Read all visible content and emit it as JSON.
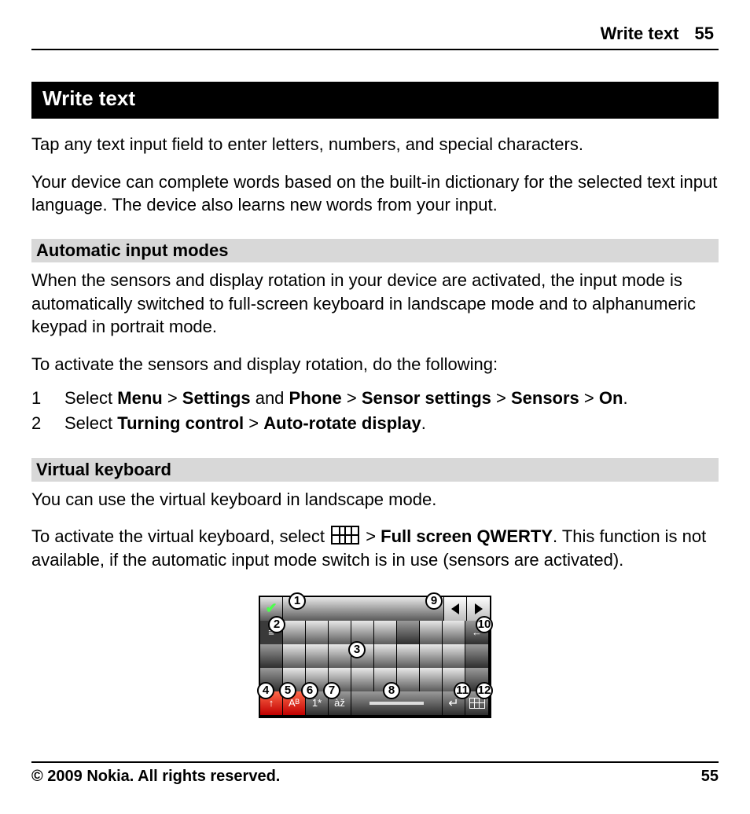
{
  "header": {
    "section": "Write text",
    "page": "55"
  },
  "title": "Write text",
  "para1": "Tap any text input field to enter letters, numbers, and special characters.",
  "para2": "Your device can complete words based on the built-in dictionary for the selected text input language. The device also learns new words from your input.",
  "sub1": "Automatic input modes",
  "para3": "When the sensors and display rotation in your device are activated, the input mode is automatically switched to full-screen keyboard in landscape mode and to alphanumeric keypad in portrait mode.",
  "para4": "To activate the sensors and display rotation, do the following:",
  "steps": {
    "s1": {
      "num": "1",
      "pre": "Select ",
      "m1": "Menu",
      "sep1": " > ",
      "m2": "Settings",
      "mid": " and ",
      "m3": "Phone",
      "sep2": " > ",
      "m4": "Sensor settings",
      "sep3": " > ",
      "m5": "Sensors",
      "sep4": " > ",
      "m6": "On",
      "end": "."
    },
    "s2": {
      "num": "2",
      "pre": "Select ",
      "m1": "Turning control",
      "sep1": " > ",
      "m2": "Auto-rotate display",
      "end": "."
    }
  },
  "sub2": "Virtual keyboard",
  "para5": "You can use the virtual keyboard in landscape mode.",
  "para6a": "To activate the virtual keyboard, select ",
  "para6sep": " > ",
  "para6b": "Full screen QWERTY",
  "para6c": ". This function is not available, if the automatic input mode switch is in use (sensors are activated).",
  "kb_labels": {
    "shift": "↑",
    "abc": "Aᴮ",
    "onestar": "1*",
    "accents": "àž",
    "back": "←"
  },
  "callouts": [
    "1",
    "2",
    "3",
    "4",
    "5",
    "6",
    "7",
    "8",
    "9",
    "10",
    "11",
    "12"
  ],
  "footer": {
    "copyright": "© 2009 Nokia. All rights reserved.",
    "page": "55"
  }
}
